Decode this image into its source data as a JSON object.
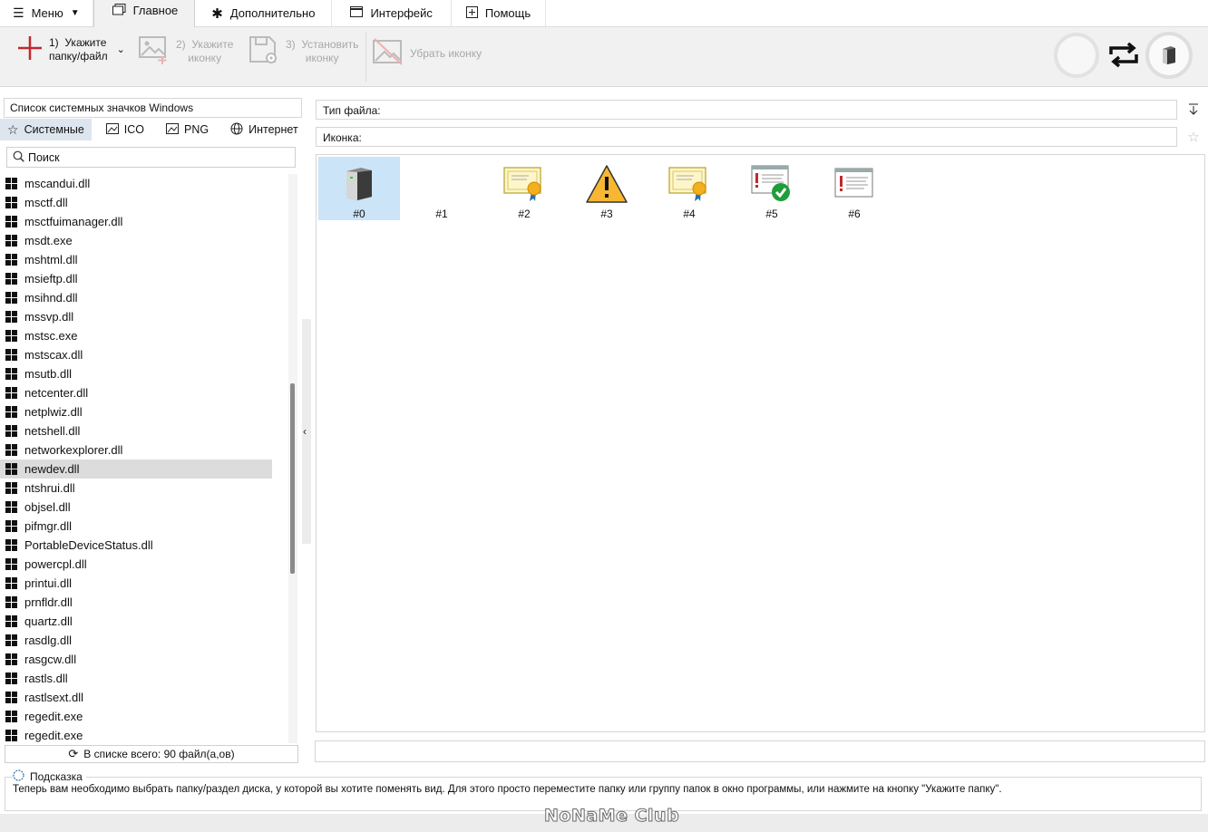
{
  "menu": {
    "menu_label": "Меню",
    "tabs": [
      {
        "label": "Главное"
      },
      {
        "label": "Дополнительно"
      },
      {
        "label": "Интерфейс"
      },
      {
        "label": "Помощь"
      }
    ]
  },
  "ribbon": {
    "step1": {
      "num": "1)",
      "line1": "Укажите",
      "line2": "папку/файл"
    },
    "step2": {
      "num": "2)",
      "line1": "Укажите",
      "line2": "иконку"
    },
    "step3": {
      "num": "3)",
      "line1": "Установить",
      "line2": "иконку"
    },
    "remove_label": "Убрать иконку"
  },
  "left": {
    "title": "Список системных значков Windows",
    "tabs": [
      "Системные",
      "ICO",
      "PNG",
      "Интернет"
    ],
    "search_placeholder": "Поиск",
    "files": [
      "mscandui.dll",
      "msctf.dll",
      "msctfuimanager.dll",
      "msdt.exe",
      "mshtml.dll",
      "msieftp.dll",
      "msihnd.dll",
      "mssvp.dll",
      "mstsc.exe",
      "mstscax.dll",
      "msutb.dll",
      "netcenter.dll",
      "netplwiz.dll",
      "netshell.dll",
      "networkexplorer.dll",
      "newdev.dll",
      "ntshrui.dll",
      "objsel.dll",
      "pifmgr.dll",
      "PortableDeviceStatus.dll",
      "powercpl.dll",
      "printui.dll",
      "prnfldr.dll",
      "quartz.dll",
      "rasdlg.dll",
      "rasgcw.dll",
      "rastls.dll",
      "rastlsext.dll",
      "regedit.exe",
      "regedit.exe"
    ],
    "selected_file": "newdev.dll",
    "status": "В списке всего: 90 файл(а,ов)"
  },
  "right": {
    "file_type_label": "Тип файла:",
    "icon_label": "Иконка:",
    "icons": [
      {
        "num": "#0",
        "icon": "computer-tower-icon",
        "selected": true
      },
      {
        "num": "#1",
        "icon": "blank-icon",
        "selected": false
      },
      {
        "num": "#2",
        "icon": "certificate-icon",
        "selected": false
      },
      {
        "num": "#3",
        "icon": "warning-icon",
        "selected": false
      },
      {
        "num": "#4",
        "icon": "certificate-icon",
        "selected": false
      },
      {
        "num": "#5",
        "icon": "window-check-icon",
        "selected": false
      },
      {
        "num": "#6",
        "icon": "window-error-icon",
        "selected": false
      }
    ]
  },
  "hint": {
    "title": "Подсказка",
    "text": "Теперь вам необходимо выбрать папку/раздел диска, у которой вы хотите поменять вид. Для этого просто переместите папку или группу папок в окно программы, или нажмите на кнопку \"Укажите папку\"."
  },
  "watermark": "NoNaMe Club",
  "colors": {
    "selection": "#cce4f7",
    "ribbon_bg": "#f1f1f1",
    "accent_red": "#c0282d"
  }
}
